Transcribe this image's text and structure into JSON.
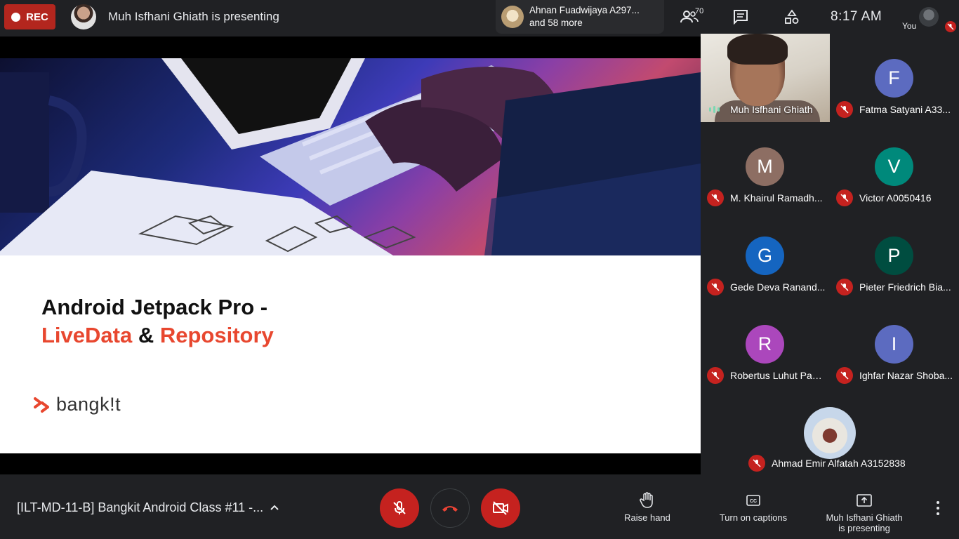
{
  "topbar": {
    "rec_label": "REC",
    "presenting_text": "Muh Isfhani Ghiath is presenting",
    "notification": {
      "line1": "Ahnan Fuadwijaya A297...",
      "line2": "and 58 more"
    },
    "people_count": "70",
    "clock": "8:17  AM",
    "you_label": "You"
  },
  "slide": {
    "title_line1": "Android Jetpack Pro -",
    "title_part_a": "LiveData",
    "title_amp": " & ",
    "title_part_b": "Repository",
    "brand": "bangk!t",
    "accent_color": "#e8472f"
  },
  "participants": [
    {
      "name": "Muh Isfhani Ghiath",
      "initial": "",
      "color": "",
      "video": true
    },
    {
      "name": "Fatma Satyani A33...",
      "initial": "F",
      "color": "#5c6bc0"
    },
    {
      "name": "M. Khairul Ramadh...",
      "initial": "M",
      "color": "#8d6e63"
    },
    {
      "name": "Victor A0050416",
      "initial": "V",
      "color": "#00897b"
    },
    {
      "name": "Gede Deva Ranand...",
      "initial": "G",
      "color": "#1565c0"
    },
    {
      "name": "Pieter Friedrich Bia...",
      "initial": "P",
      "color": "#004d40"
    },
    {
      "name": "Robertus Luhut Pan...",
      "initial": "R",
      "color": "#ab47bc"
    },
    {
      "name": "Ighfar Nazar Shoba...",
      "initial": "I",
      "color": "#5c6bc0"
    }
  ],
  "featured_participant": {
    "name": "Ahmad Emir Alfatah A3152838"
  },
  "bottombar": {
    "meeting_title": "[ILT-MD-11-B] Bangkit Android Class #11 -...",
    "raise_hand": "Raise hand",
    "captions": "Turn on captions",
    "presenting_line1": "Muh Isfhani Ghiath",
    "presenting_line2": "is presenting"
  }
}
